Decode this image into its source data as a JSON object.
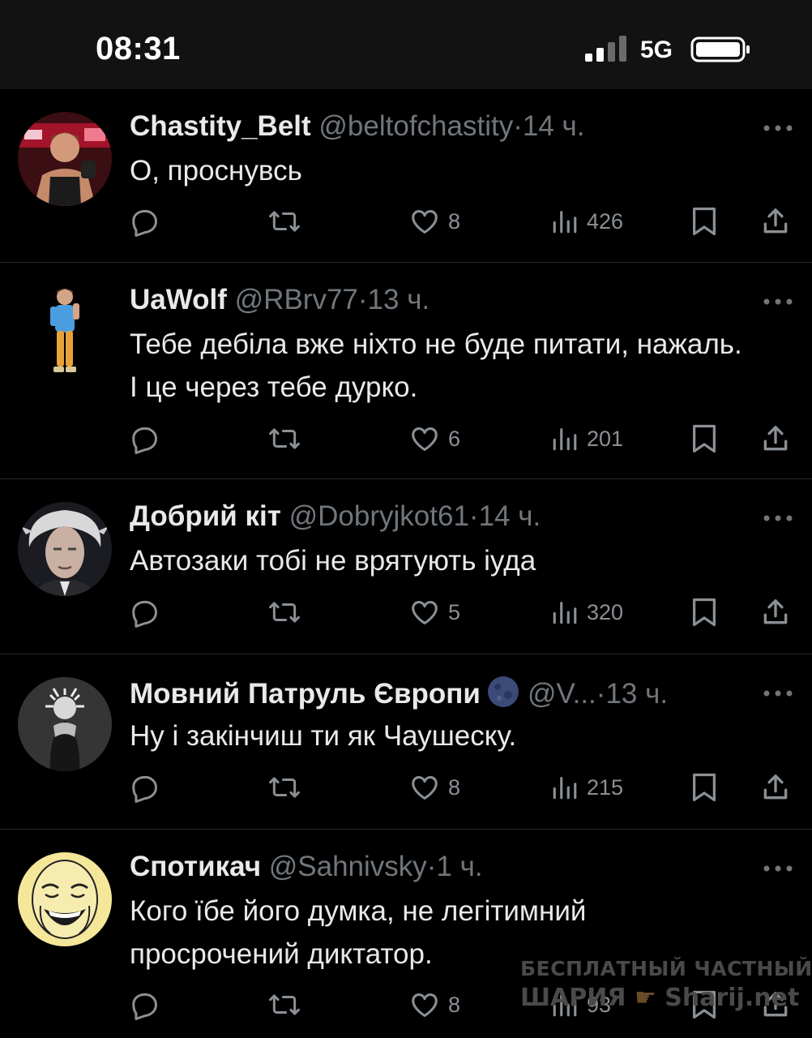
{
  "status_bar": {
    "time": "08:31",
    "network": "5G",
    "icons": [
      "signal-icon",
      "battery-icon"
    ]
  },
  "icons": {
    "reply": "reply-icon",
    "repost": "repost-icon",
    "like": "heart-icon",
    "views": "views-icon",
    "bookmark": "bookmark-icon",
    "share": "share-icon",
    "more": "more-icon"
  },
  "tweets": [
    {
      "name": "Chastity_Belt",
      "handle": "@beltofchastity",
      "separator": "·",
      "time": "14 ч.",
      "text": "О, проснувсь",
      "likes": "8",
      "views": "426"
    },
    {
      "name": "UaWolf",
      "handle": "@RBrv77",
      "separator": "·",
      "time": "13 ч.",
      "text": "Тебе дебіла вже ніхто не буде питати, нажаль. І це через тебе дурко.",
      "likes": "6",
      "views": "201"
    },
    {
      "name": "Добрий кіт",
      "handle": "@Dobryjkot61",
      "separator": "·",
      "time": "14 ч.",
      "text": "Автозаки тобі не врятують іуда",
      "likes": "5",
      "views": "320"
    },
    {
      "name": "Мовний Патруль Європи",
      "handle": "@V...",
      "separator": "·",
      "time": "13 ч.",
      "text": "Ну і закінчиш ти як Чаушеску.",
      "likes": "8",
      "views": "215"
    },
    {
      "name": "Спотикач",
      "handle": "@Sahnivsky",
      "separator": "·",
      "time": "1 ч.",
      "text": "Кого їбе його думка, не легітимний просрочений диктатор.",
      "likes": "8",
      "views": "93"
    }
  ],
  "watermark": {
    "line1": "БЕСПЛАТНЫЙ ЧАСТНЫЙ",
    "line2": "ШАРИЯ",
    "line3": "Sharij.net"
  }
}
